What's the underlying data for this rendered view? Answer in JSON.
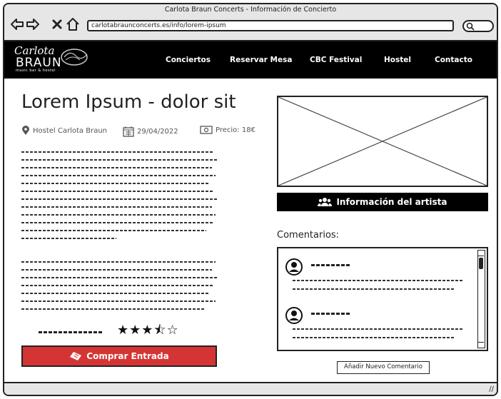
{
  "window": {
    "title": "Carlota Braun Concerts - Información de Concierto"
  },
  "browser": {
    "url": "carlotabraunconcerts.es/info/lorem-ipsum"
  },
  "logo": {
    "line1": "Carlota",
    "line2": "BRAUN",
    "line3": "music bar & hostel"
  },
  "menu": [
    "Conciertos",
    "Reservar Mesa",
    "CBC Festival",
    "Hostel",
    "Contacto"
  ],
  "concert": {
    "title": "Lorem Ipsum - dolor sit",
    "venue": "Hostel Carlota Braun",
    "date": "29/04/2022",
    "price": "Precio: 18€",
    "rating": 3.5,
    "stars": "★★★⯪☆"
  },
  "buttons": {
    "buy": "Comprar Entrada",
    "artist_info": "Información del artista",
    "add_comment": "Añadir Nuevo Comentario"
  },
  "comments": {
    "heading": "Comentarios:"
  },
  "icons": [
    "back-arrow-icon",
    "forward-arrow-icon",
    "close-icon",
    "home-icon",
    "search-icon",
    "location-pin-icon",
    "calendar-icon",
    "money-icon",
    "ticket-icon",
    "users-icon",
    "user-avatar-icon"
  ]
}
